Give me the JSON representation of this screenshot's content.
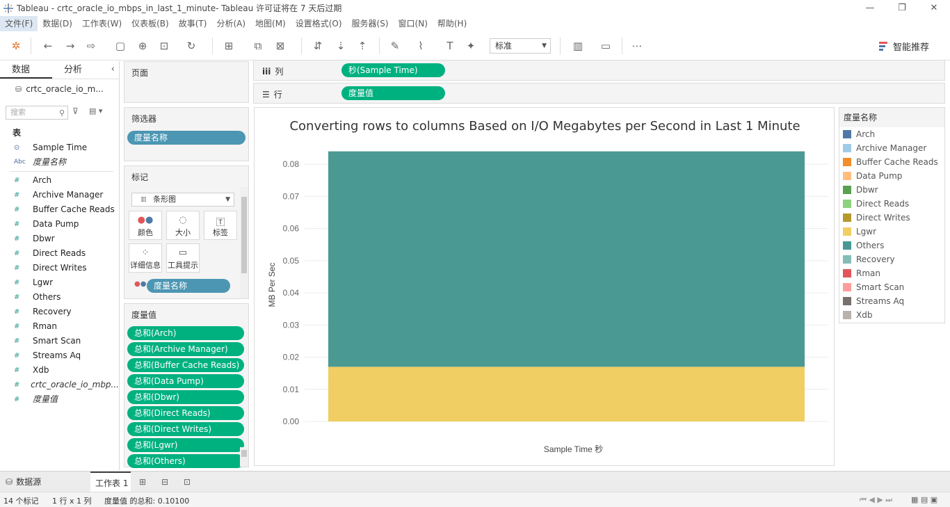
{
  "window": {
    "title": "Tableau - crtc_oracle_io_mbps_in_last_1_minute- Tableau 许可证将在 7 天后过期",
    "buttons": [
      "—",
      "❐",
      "✕"
    ]
  },
  "menu": [
    "文件(F)",
    "数据(D)",
    "工作表(W)",
    "仪表板(B)",
    "故事(T)",
    "分析(A)",
    "地图(M)",
    "设置格式(O)",
    "服务器(S)",
    "窗口(N)",
    "帮助(H)"
  ],
  "toolbar": {
    "fit_select": "标准",
    "smart_label": "智能推荐"
  },
  "left_pane": {
    "tab_data": "数据",
    "tab_analysis": "分析",
    "datasource": "crtc_oracle_io_m...",
    "search_placeholder": "搜索",
    "section_table": "表",
    "dimensions": [
      {
        "icon": "date",
        "name": "Sample Time"
      },
      {
        "icon": "Abc",
        "name": "度量名称"
      }
    ],
    "measures": [
      "Arch",
      "Archive Manager",
      "Buffer Cache Reads",
      "Data Pump",
      "Dbwr",
      "Direct Reads",
      "Direct Writes",
      "Lgwr",
      "Others",
      "Recovery",
      "Rman",
      "Smart Scan",
      "Streams Aq",
      "Xdb"
    ],
    "extra_measures": [
      "crtc_oracle_io_mbp...",
      "度量值"
    ]
  },
  "cards": {
    "pages": "页面",
    "filters": "筛选器",
    "filter_pill": "度量名称",
    "marks": "标记",
    "mark_type": "条形图",
    "mark_buttons": [
      "颜色",
      "大小",
      "标签",
      "详细信息",
      "工具提示"
    ],
    "marks_pill": "度量名称",
    "measure_values": "度量值",
    "measure_pills": [
      "总和(Arch)",
      "总和(Archive Manager)",
      "总和(Buffer Cache Reads)",
      "总和(Data Pump)",
      "总和(Dbwr)",
      "总和(Direct Reads)",
      "总和(Direct Writes)",
      "总和(Lgwr)",
      "总和(Others)"
    ]
  },
  "shelves": {
    "columns_label": "列",
    "columns_pill": "秒(Sample Time)",
    "rows_label": "行",
    "rows_pill": "度量值"
  },
  "chart_data": {
    "type": "bar",
    "stacked": true,
    "title": "Converting rows to columns Based on I/O Megabytes per Second in Last 1 Minute",
    "xlabel": "Sample Time 秒",
    "ylabel": "MB Per Sec",
    "ylim": [
      0,
      0.085
    ],
    "yticks": [
      "0.00",
      "0.01",
      "0.02",
      "0.03",
      "0.04",
      "0.05",
      "0.06",
      "0.07",
      "0.08"
    ],
    "ytick_values": [
      0,
      0.01,
      0.02,
      0.03,
      0.04,
      0.05,
      0.06,
      0.07,
      0.08
    ],
    "grid": true,
    "series": [
      {
        "name": "Lgwr",
        "value": 0.017,
        "color": "#f0ce63"
      },
      {
        "name": "Others",
        "value": 0.067,
        "color": "#4a9a93"
      }
    ]
  },
  "legend": {
    "title": "度量名称",
    "items": [
      {
        "name": "Arch",
        "color": "#4e79a7"
      },
      {
        "name": "Archive Manager",
        "color": "#a0cbe8"
      },
      {
        "name": "Buffer Cache Reads",
        "color": "#f28e2b"
      },
      {
        "name": "Data Pump",
        "color": "#ffbe7d"
      },
      {
        "name": "Dbwr",
        "color": "#59a14f"
      },
      {
        "name": "Direct Reads",
        "color": "#8cd17d"
      },
      {
        "name": "Direct Writes",
        "color": "#b6992d"
      },
      {
        "name": "Lgwr",
        "color": "#f1ce63"
      },
      {
        "name": "Others",
        "color": "#499894"
      },
      {
        "name": "Recovery",
        "color": "#86bcb6"
      },
      {
        "name": "Rman",
        "color": "#e15759"
      },
      {
        "name": "Smart Scan",
        "color": "#ff9d9a"
      },
      {
        "name": "Streams Aq",
        "color": "#79706e"
      },
      {
        "name": "Xdb",
        "color": "#bab0ac"
      }
    ]
  },
  "sheets": {
    "datasource_tab": "数据源",
    "sheet1": "工作表 1"
  },
  "status": {
    "marks": "14 个标记",
    "rows_cols": "1 行 x 1 列",
    "sum": "度量值 的总和: 0.10100"
  }
}
